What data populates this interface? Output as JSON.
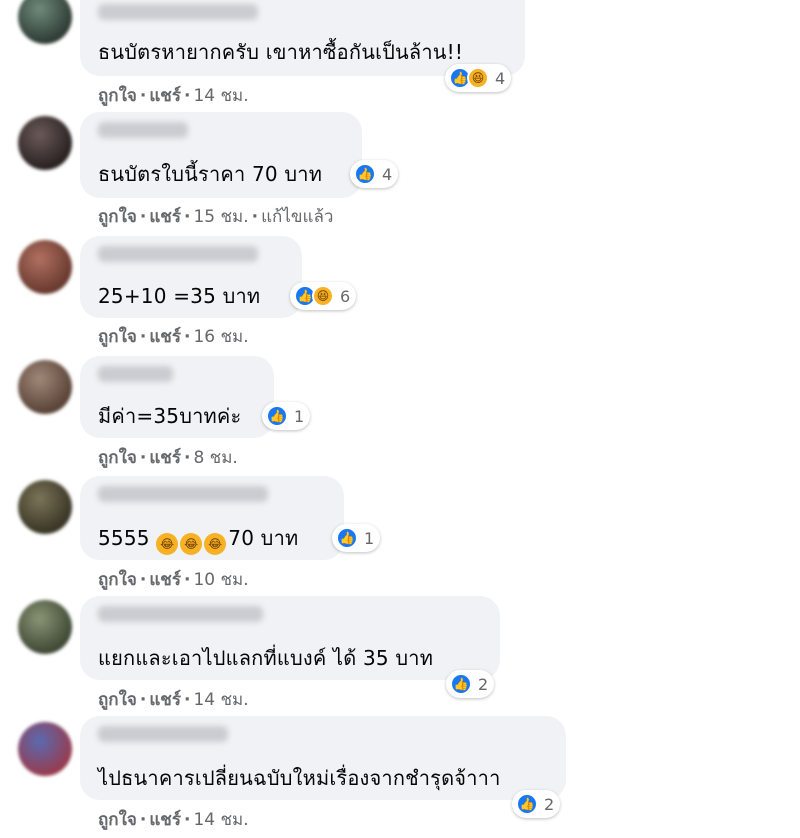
{
  "meta_labels": {
    "like": "ถูกใจ",
    "share": "แชร์",
    "dot": "·"
  },
  "comments": [
    {
      "text": "ธนบัตรหายากครับ เขาหาซื้อกันเป็นล้าน!!",
      "reaction_count": "4",
      "reactions": [
        "like-icon",
        "haha-icon"
      ],
      "time": "14 ชม.",
      "edited": ""
    },
    {
      "text": "ธนบัตรใบนี้ราคา 70 บาท",
      "reaction_count": "4",
      "reactions": [
        "like-icon"
      ],
      "time": "15 ชม.",
      "edited": "แก้ไขแล้ว"
    },
    {
      "text": "25+10 =35 บาท",
      "reaction_count": "6",
      "reactions": [
        "like-icon",
        "haha-icon"
      ],
      "time": "16 ชม.",
      "edited": ""
    },
    {
      "text": "มีค่า=35บาทค่ะ",
      "reaction_count": "1",
      "reactions": [
        "like-icon"
      ],
      "time": "8 ชม.",
      "edited": ""
    },
    {
      "text_prefix": "5555",
      "text_suffix": "70 บาท",
      "reaction_count": "1",
      "reactions": [
        "like-icon"
      ],
      "time": "10 ชม.",
      "edited": ""
    },
    {
      "text": "แยกและเอาไปแลกที่แบงค์ ได้ 35 บาท",
      "reaction_count": "2",
      "reactions": [
        "like-icon"
      ],
      "time": "14 ชม.",
      "edited": ""
    },
    {
      "text": "ไปธนาคารเปลี่ยนฉบับใหม่เรื่องจากชำรุดจ้าาา",
      "reaction_count": "2",
      "reactions": [
        "like-icon"
      ],
      "time": "14 ชม.",
      "edited": ""
    }
  ]
}
